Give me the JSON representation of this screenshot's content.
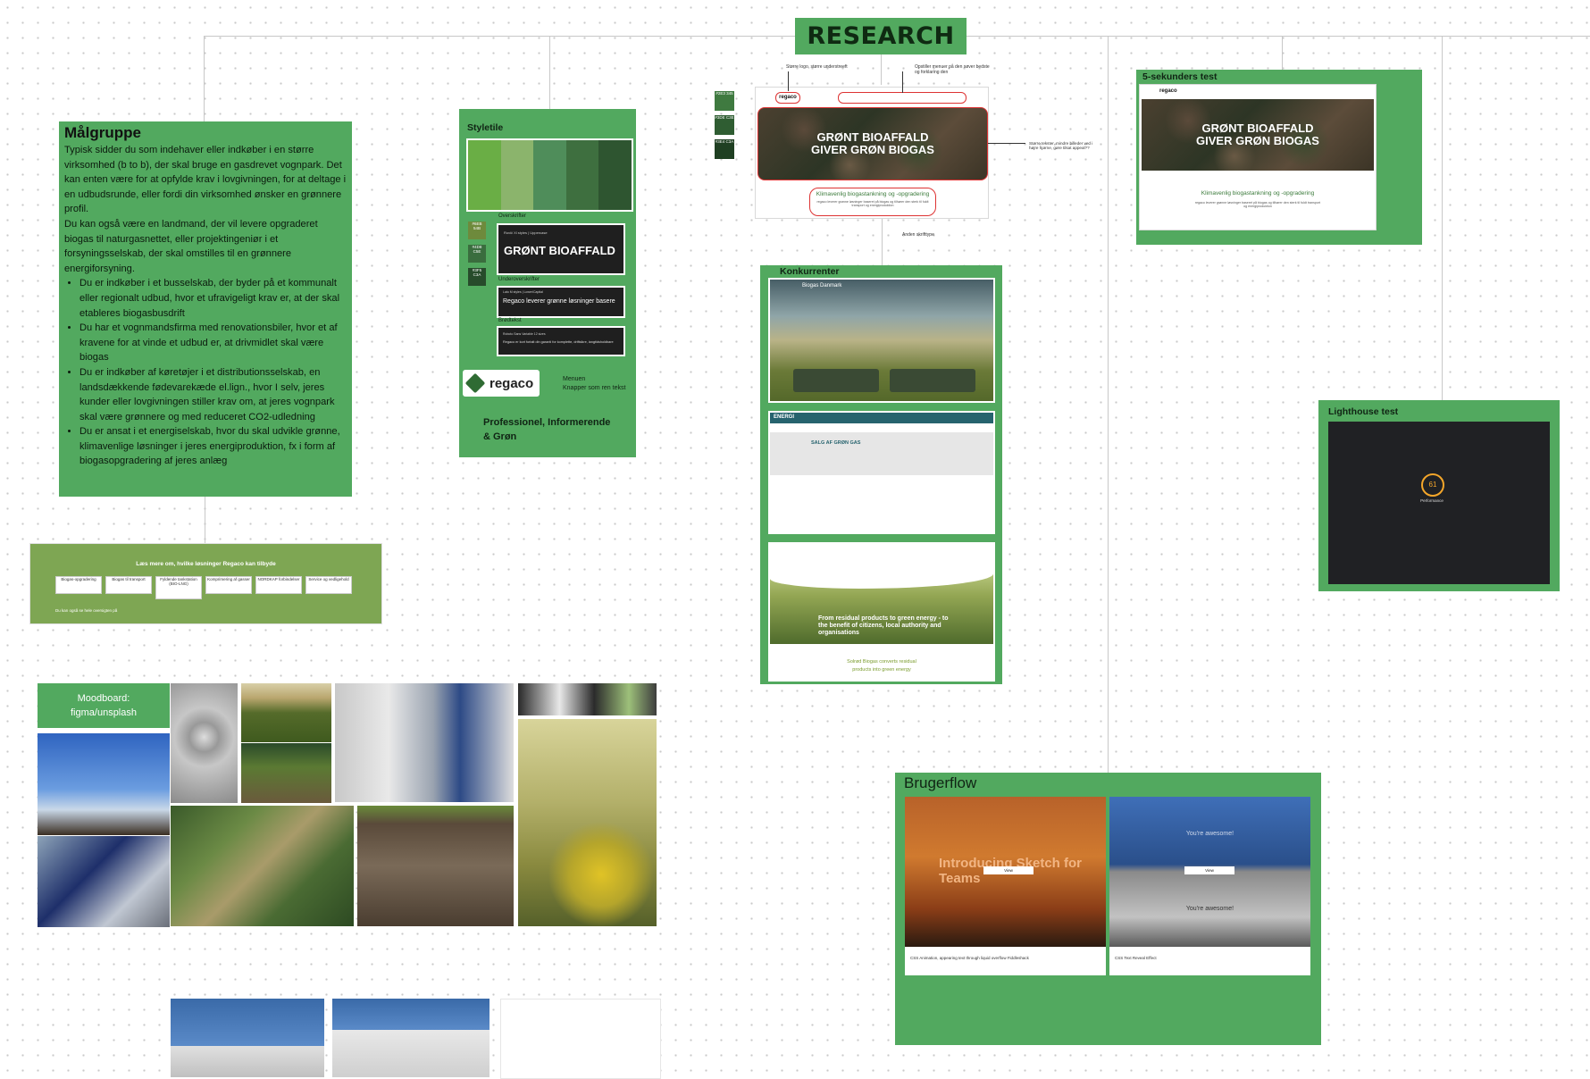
{
  "research_title": "RESEARCH",
  "malgruppe": {
    "heading": "Målgruppe",
    "para1": "Typisk sidder du som indehaver eller indkøber i en større virksomhed (b to b), der skal bruge en gasdrevet vognpark. Det kan enten være for at opfylde krav i lovgivningen, for at deltage i en udbudsrunde, eller fordi din virksomhed ønsker en grønnere profil.",
    "para2": "Du kan også være en landmand, der vil levere opgraderet biogas til naturgasnettet, eller projektingeniør i et forsyningsselskab, der skal omstilles til en grønnere energiforsyning.",
    "bullets": [
      "Du er indkøber i et busselskab, der byder på et kommunalt eller regionalt udbud, hvor et ufravigeligt krav er, at der skal etableres biogasbusdrift",
      "Du har et vognmandsfirma med renovationsbiler, hvor et af kravene for at vinde et udbud er, at drivmidlet skal være biogas",
      "Du er indkøber af køretøjer i et distributionsselskab, en landsdækkende fødevarekæde el.lign., hvor I selv, jeres kunder eller lovgivningen stiller krav om, at jeres vognpark skal være grønnere og med reduceret CO2-udledning",
      "Du er ansat i et energiselskab, hvor du skal udvikle grønne, klimavenlige løsninger i jeres energiproduktion, fx i form af biogasopgradering af jeres anlæg"
    ]
  },
  "styletile": {
    "heading": "Styletile",
    "colors": [
      "#6aae45",
      "#8bb46c",
      "#4f8d5a",
      "#3e6f3f",
      "#2e5530"
    ],
    "chip_labels": [
      "#6EB 54B",
      "#4D8 C5E",
      "#3F5 C3A"
    ],
    "overskrifter_label": "Overskrifter",
    "overskrift_meta": "Rovič   Xl styles   |   Uppercase",
    "overskrift_sample": "GRØNT BIOAFFALD",
    "underoverskrifter_label": "Underoverskrifter",
    "underoverskrift_meta": "Lato   M styles   |   Lower/Capital",
    "underoverskrift_sample": "Regaco leverer grønne løsninger basere",
    "broedtekst_label": "Brødtekst",
    "broedtekst_meta": "Roboto Sans   Variable 12 sizes",
    "broedtekst_sample": "Regaco er kort fortalt din garanti for komplette, driftsikre, langtidsholdbare",
    "logo_text": "regaco",
    "logo_note1": "Menuen",
    "logo_note2": "Knapper som ren tekst",
    "tagline": "Professionel, Informerende & Grøn"
  },
  "side_swatches": [
    "#2E3 345",
    "#3DE C3E",
    "#3E4 C3A"
  ],
  "annotated_site": {
    "hero_line1": "GRØNT BIOAFFALD",
    "hero_line2": "GIVER GRØN BIOGAS",
    "subhead": "Klimavenlig biogastankning og -opgradering",
    "body": "regaco leverer grønne løsninger baseret på biogas og tilhører den sterk til fuldt transport og energiproduktion",
    "logo": "regaco",
    "note_logo": "Større logo, større understreeft",
    "note_menu": "Opstiller menuer på den søver bedste og forklaring den",
    "note_hero": "Større tekster, mindre billeder ved i højre hjørne, gøre tilsat appeal??",
    "note_font": "Anden skrifttype"
  },
  "five_second": {
    "heading": "5-sekunders test",
    "hero_line1": "GRØNT BIOAFFALD",
    "hero_line2": "GIVER GRØN BIOGAS",
    "subhead": "Klimavenlig biogastankning og -opgradering",
    "body": "regaco leverer grønne løsninger baseret på biogas og tilhører den sterk til fuldt transport og energiproduktion",
    "logo": "regaco"
  },
  "konkurrenter": {
    "heading": "Konkurrenter",
    "site1_brand": "Biogas Danmark",
    "site2_brand": "ENERGI",
    "site2_heading": "SALG AF GRØN GAS",
    "site3_banner": "From residual products to green energy - to the benefit of citizens, local authority and organisations",
    "site3_footer1": "Solrød Biogas converts residual",
    "site3_footer2": "products into green energy"
  },
  "lighthouse": {
    "heading": "Lighthouse test",
    "score": "61",
    "label": "Performance"
  },
  "regaco_box": {
    "heading": "Læs mere om, hvilke løsninger Regaco kan tilbyde",
    "buttons": [
      "Biogas-opgradering",
      "Biogas til transport",
      "Fyldende tankstation (BIO-LNG)",
      "Komprimering af gasser",
      "NORDKAP forbindelser",
      "Service og vedligehold"
    ],
    "footer": "Du kan også se hele oversigten på"
  },
  "moodboard": {
    "label": "Moodboard: figma/unsplash"
  },
  "brugerflow": {
    "heading": "Brugerflow",
    "card1_text": "Introducing Sketch for Teams",
    "card1_caption": "CSS Animation, appearing text through liquid overflow Fiddleshack",
    "card2_text_top": "You're awesome!",
    "card2_text_bottom": "You're awesome!",
    "card2_caption": "CSS Text Reveal Effect",
    "view_label": "View"
  }
}
